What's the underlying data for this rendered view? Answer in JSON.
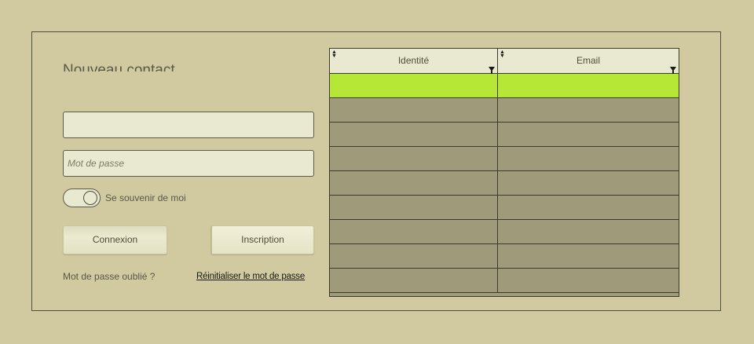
{
  "form": {
    "title": "Nouveau contact",
    "identity_value": "",
    "identity_placeholder": "",
    "password_placeholder": "Mot de passe",
    "remember_label": "Se souvenir de moi",
    "remember_on": true,
    "login_label": "Connexion",
    "signup_label": "Inscription",
    "forgot_label": "Mot de passe oublié ?",
    "reset_link": "Réinitialiser le mot de passe"
  },
  "grid": {
    "columns": [
      "Identité",
      "Email"
    ],
    "rows": [
      [
        "",
        ""
      ],
      [
        "",
        ""
      ],
      [
        "",
        ""
      ],
      [
        "",
        ""
      ],
      [
        "",
        ""
      ],
      [
        "",
        ""
      ],
      [
        "",
        ""
      ],
      [
        "",
        ""
      ],
      [
        "",
        ""
      ]
    ],
    "selected_row": 0
  },
  "colors": {
    "background": "#d1c9a0",
    "selected_row": "#b6e636",
    "row": "#9f9a79",
    "header": "#e9e8d0"
  }
}
